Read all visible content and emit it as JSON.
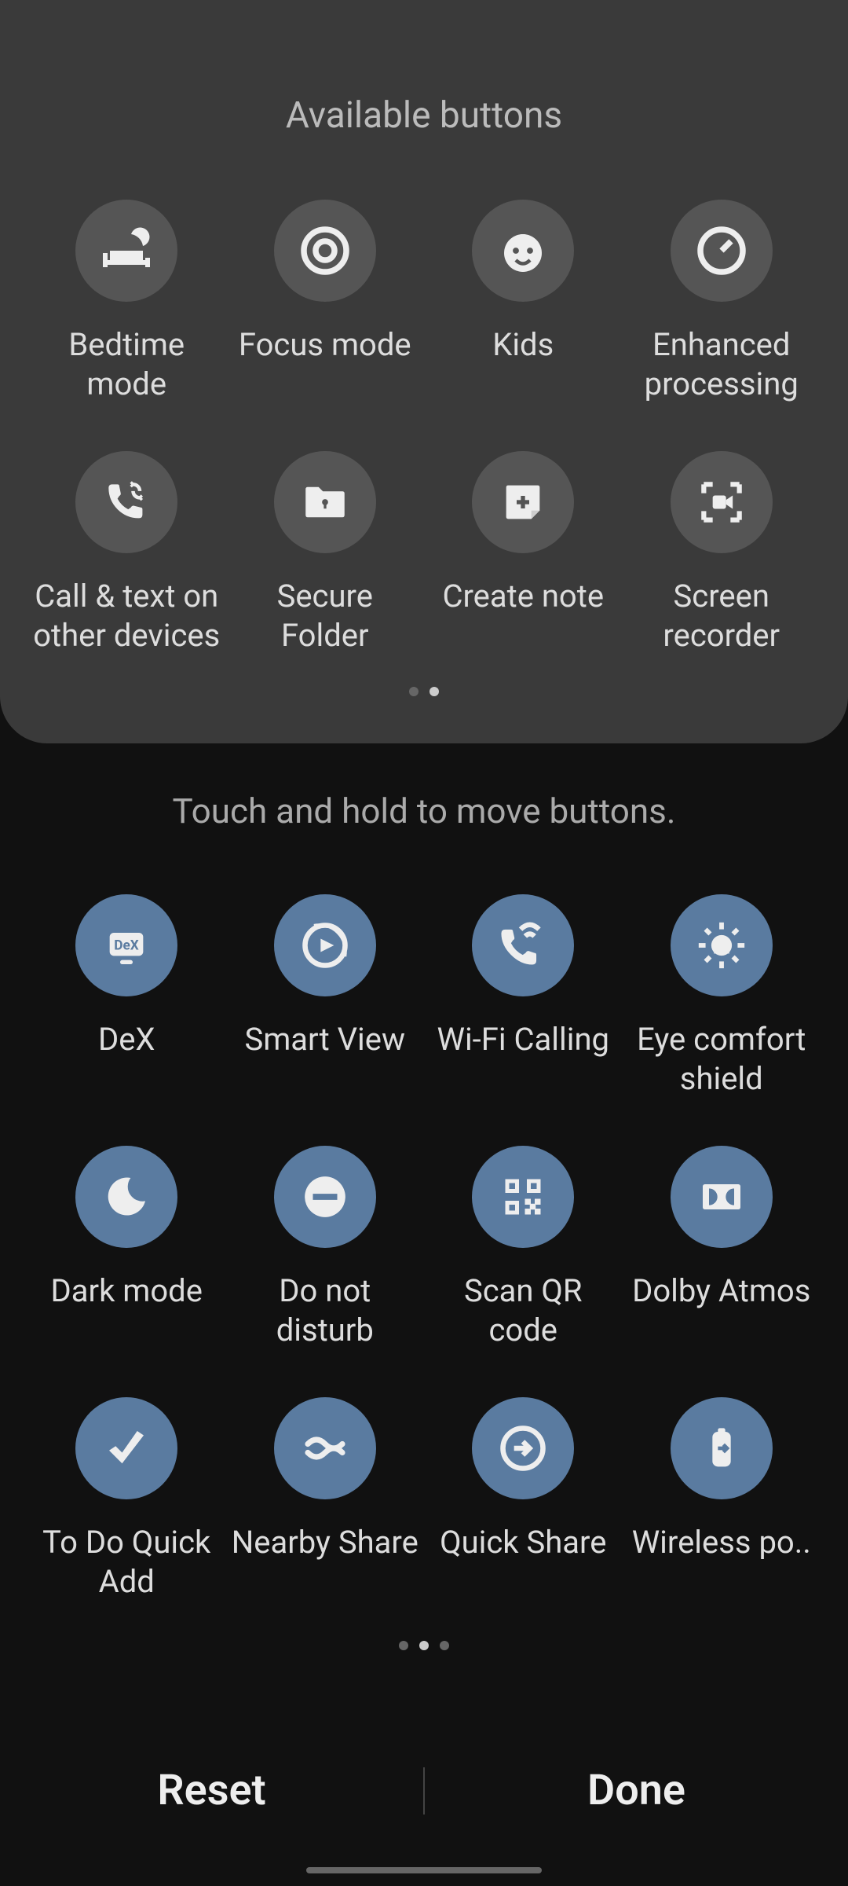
{
  "available": {
    "title": "Available buttons",
    "buttons": [
      {
        "label": "Bedtime mode",
        "icon": "bed"
      },
      {
        "label": "Focus mode",
        "icon": "focus"
      },
      {
        "label": "Kids",
        "icon": "kids"
      },
      {
        "label": "Enhanced processing",
        "icon": "enhanced"
      },
      {
        "label": "Call & text on other devices",
        "icon": "callsync"
      },
      {
        "label": "Secure Folder",
        "icon": "secure"
      },
      {
        "label": "Create note",
        "icon": "note"
      },
      {
        "label": "Screen recorder",
        "icon": "screenrec"
      }
    ],
    "page_count": 2,
    "page_active": 1
  },
  "instruction": "Touch and hold to move buttons.",
  "active": {
    "buttons": [
      {
        "label": "DeX",
        "icon": "dex"
      },
      {
        "label": "Smart View",
        "icon": "smartview"
      },
      {
        "label": "Wi-Fi Calling",
        "icon": "wificall"
      },
      {
        "label": "Eye comfort shield",
        "icon": "eyecomfort"
      },
      {
        "label": "Dark mode",
        "icon": "darkmode"
      },
      {
        "label": "Do not disturb",
        "icon": "dnd"
      },
      {
        "label": "Scan QR code",
        "icon": "qr"
      },
      {
        "label": "Dolby Atmos",
        "icon": "dolby"
      },
      {
        "label": "To Do Quick Add",
        "icon": "todo"
      },
      {
        "label": "Nearby Share",
        "icon": "nearby"
      },
      {
        "label": "Quick Share",
        "icon": "quickshare"
      },
      {
        "label": "Wireless po..",
        "icon": "wirelesspower"
      }
    ],
    "page_count": 3,
    "page_active": 1
  },
  "footer": {
    "reset_label": "Reset",
    "done_label": "Done"
  },
  "colors": {
    "gray_circle": "#555555",
    "blue_circle": "#5a7ba0",
    "panel_bg": "#3a3a3a",
    "screen_bg": "#111111"
  }
}
